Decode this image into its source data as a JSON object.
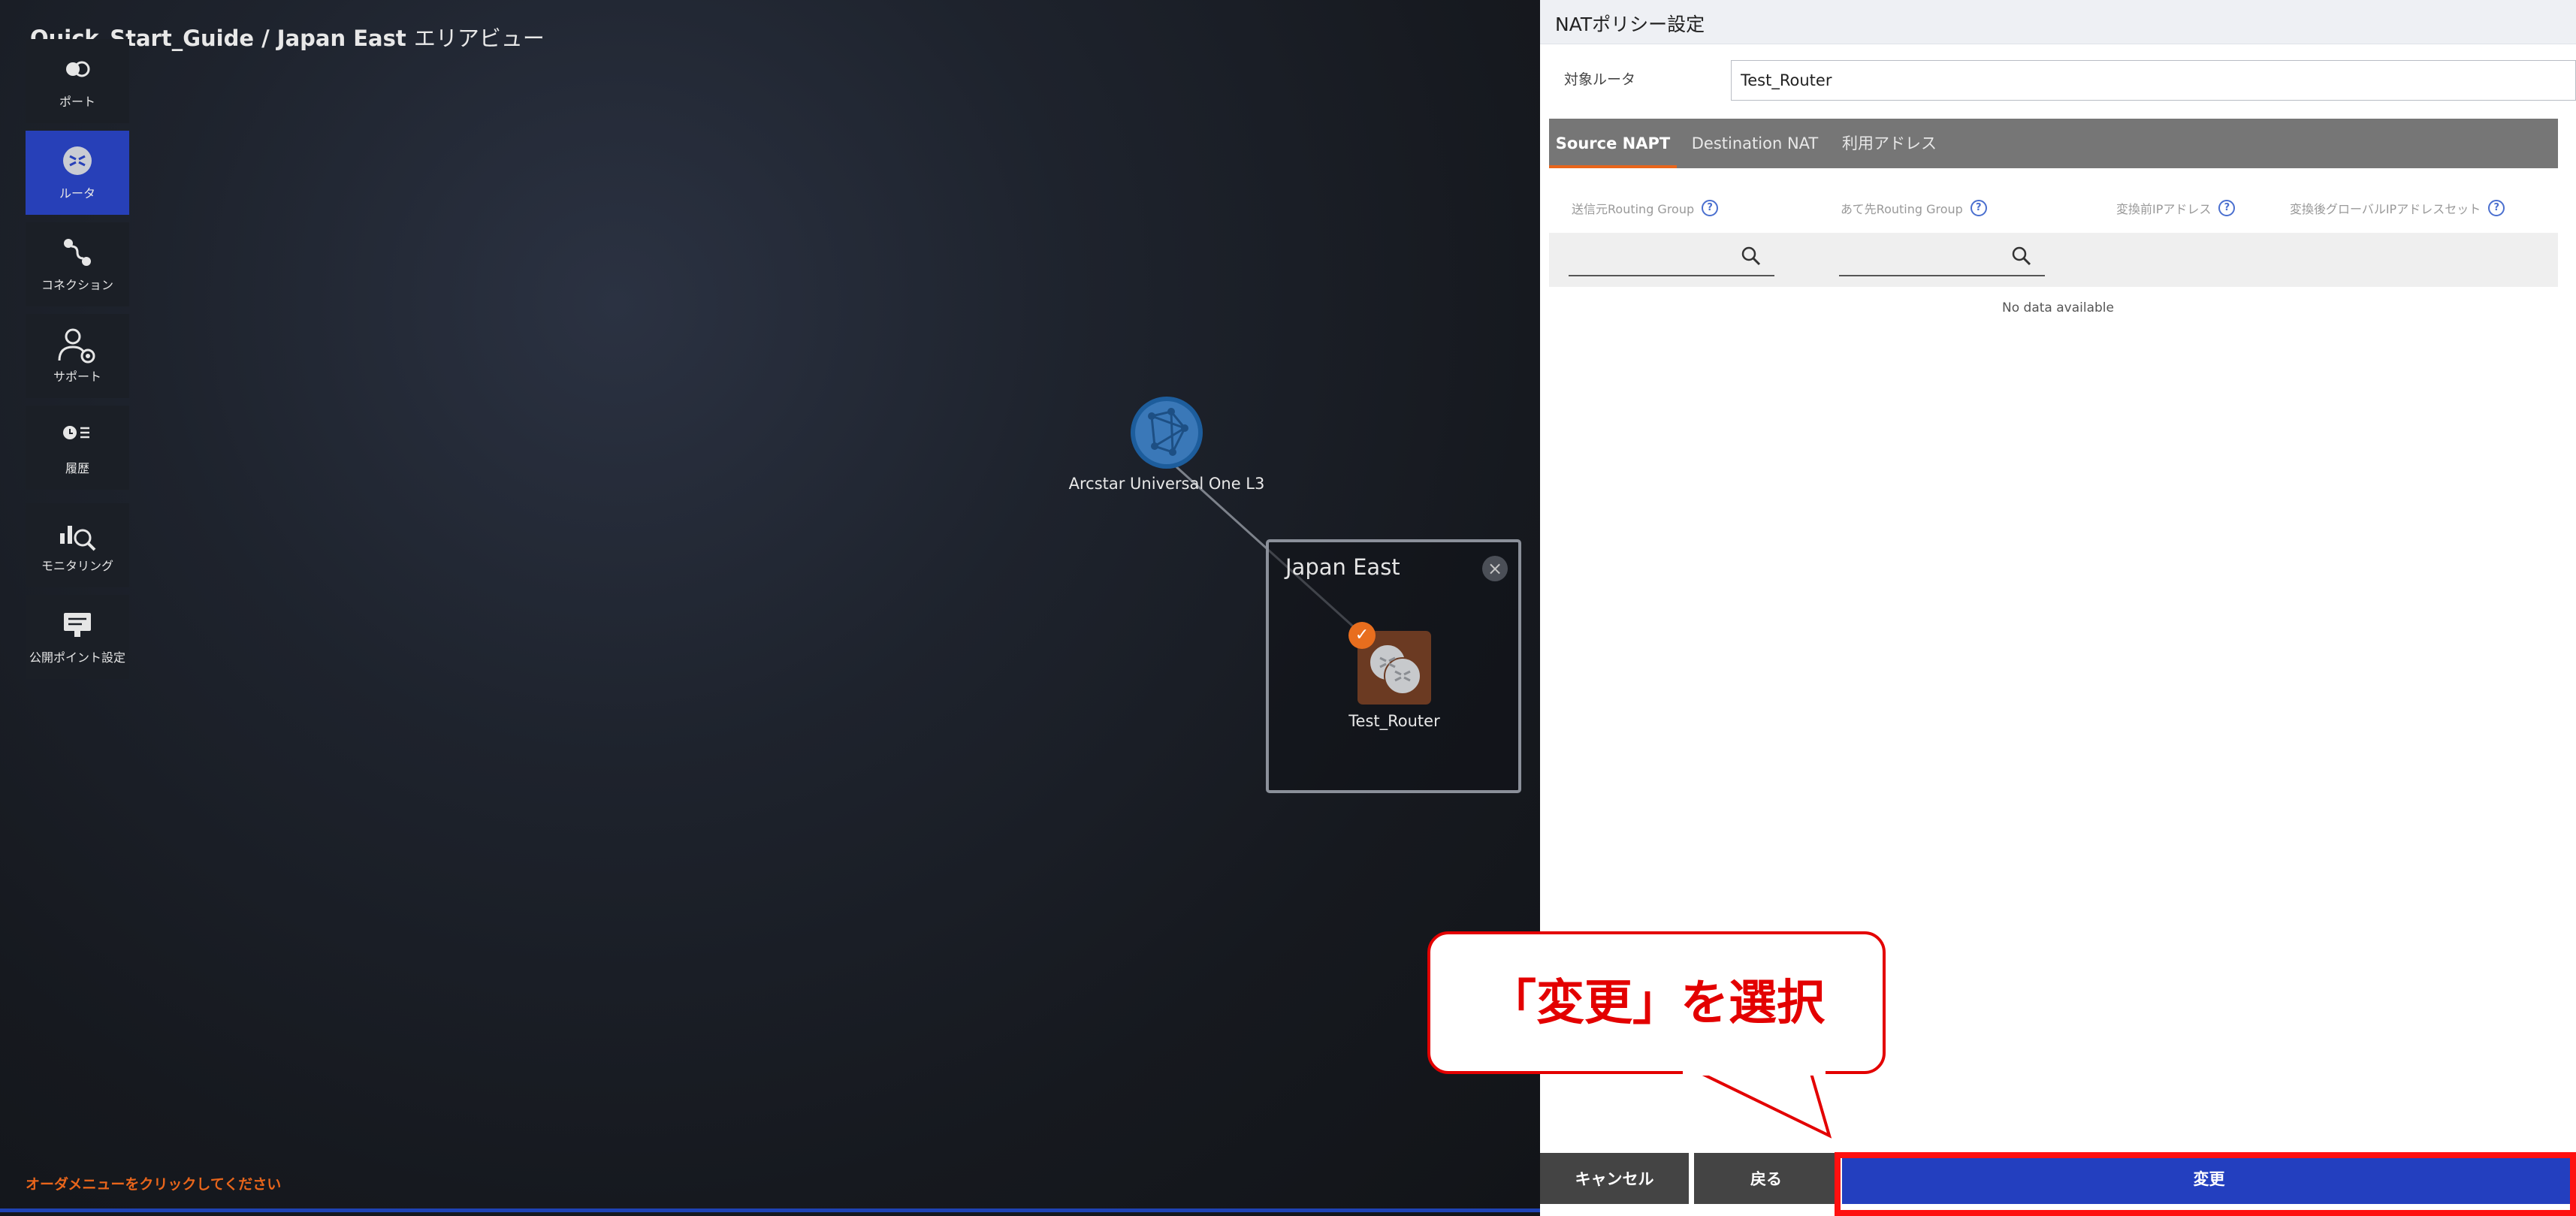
{
  "breadcrumb": {
    "path": "Quick_Start_Guide / Japan East",
    "view": "エリアビュー"
  },
  "sidebar": {
    "items": [
      {
        "label": "ポート",
        "icon": "port-icon",
        "active": false
      },
      {
        "label": "ルータ",
        "icon": "router-icon",
        "active": true
      },
      {
        "label": "コネクション",
        "icon": "connection-icon",
        "active": false
      },
      {
        "label": "サポート",
        "icon": "support-icon",
        "active": false
      },
      {
        "label": "履歴",
        "icon": "history-icon",
        "active": false
      },
      {
        "label": "モニタリング",
        "icon": "monitoring-icon",
        "active": false
      },
      {
        "label": "公開ポイント設定",
        "icon": "publish-point-icon",
        "active": false
      }
    ]
  },
  "canvas": {
    "network_label": "Arcstar Universal One L3",
    "area_title": "Japan East",
    "router_label": "Test_Router",
    "order_hint": "オーダメニューをクリックしてください"
  },
  "panel": {
    "title": "NATポリシー設定",
    "target_label": "対象ルータ",
    "target_value": "Test_Router",
    "tabs": [
      "Source NAPT",
      "Destination NAT",
      "利用アドレス"
    ],
    "active_tab": "Source NAPT",
    "columns": [
      "送信元Routing Group",
      "あて先Routing Group",
      "変換前IPアドレス",
      "変換後グローバルIPアドレスセット"
    ],
    "no_data": "No data available",
    "buttons": {
      "cancel": "キャンセル",
      "back": "戻る",
      "change": "変更"
    }
  },
  "callout": {
    "text": "「変更」を選択"
  },
  "colors": {
    "accent_blue": "#233fbf",
    "highlight_red": "#ff1010",
    "router_brown": "#6b3a22",
    "orange": "#e8651b"
  }
}
